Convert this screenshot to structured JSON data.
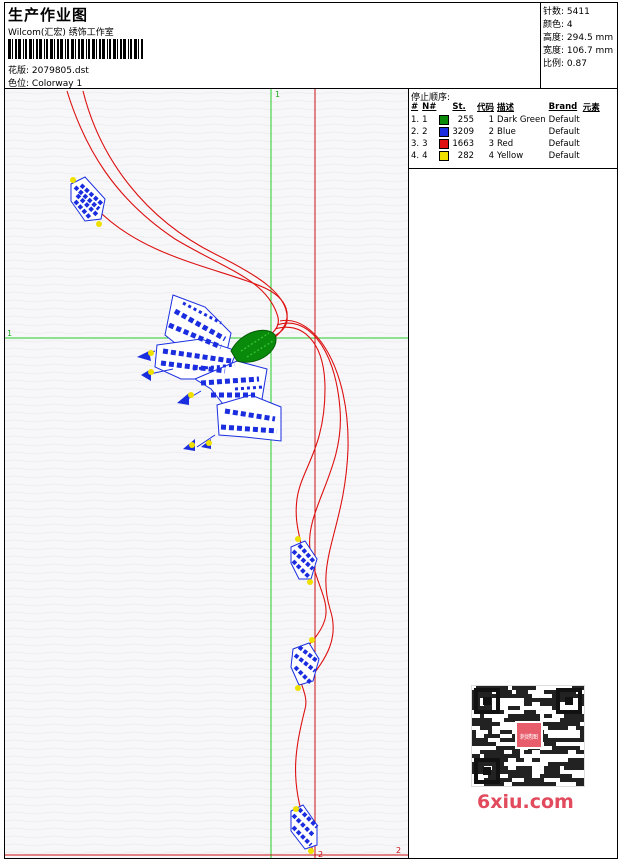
{
  "header": {
    "title": "生产作业图",
    "company": "Wilcom(汇宏) 绣饰工作室",
    "design_label": "花版:",
    "design_value": "2079805.dst",
    "colorway_label": "色位:",
    "colorway_value": "Colorway 1"
  },
  "stats": [
    {
      "label": "针数:",
      "value": "5411"
    },
    {
      "label": "颜色:",
      "value": "4"
    },
    {
      "label": "高度:",
      "value": "294.5 mm"
    },
    {
      "label": "宽度:",
      "value": "106.7 mm"
    },
    {
      "label": "比例:",
      "value": "0.87"
    }
  ],
  "stop_sequence": {
    "title": "停止顺序:",
    "columns": [
      "#",
      "N#",
      "St.",
      "代码",
      "描述",
      "Brand",
      "元素"
    ],
    "rows": [
      {
        "idx": "1.",
        "n": "1",
        "color": "#0a8a0a",
        "stitches": "255",
        "code": "1",
        "desc": "Dark Green",
        "brand": "Default"
      },
      {
        "idx": "2.",
        "n": "2",
        "color": "#1a2ee0",
        "stitches": "3209",
        "code": "2",
        "desc": "Blue",
        "brand": "Default"
      },
      {
        "idx": "3.",
        "n": "3",
        "color": "#e01010",
        "stitches": "1663",
        "code": "3",
        "desc": "Red",
        "brand": "Default"
      },
      {
        "idx": "4.",
        "n": "4",
        "color": "#f0e000",
        "stitches": "282",
        "code": "4",
        "desc": "Yellow",
        "brand": "Default"
      }
    ]
  },
  "canvas": {
    "axis_top_label": "1",
    "axis_left_label": "1",
    "axis_bottom_label": "2",
    "axis_right_label": "2",
    "guide_colors": {
      "green": "#22cc22",
      "red": "#cc1111"
    }
  },
  "watermark": {
    "brand": "6xiu.com",
    "stamp_text": "刺绣图"
  }
}
